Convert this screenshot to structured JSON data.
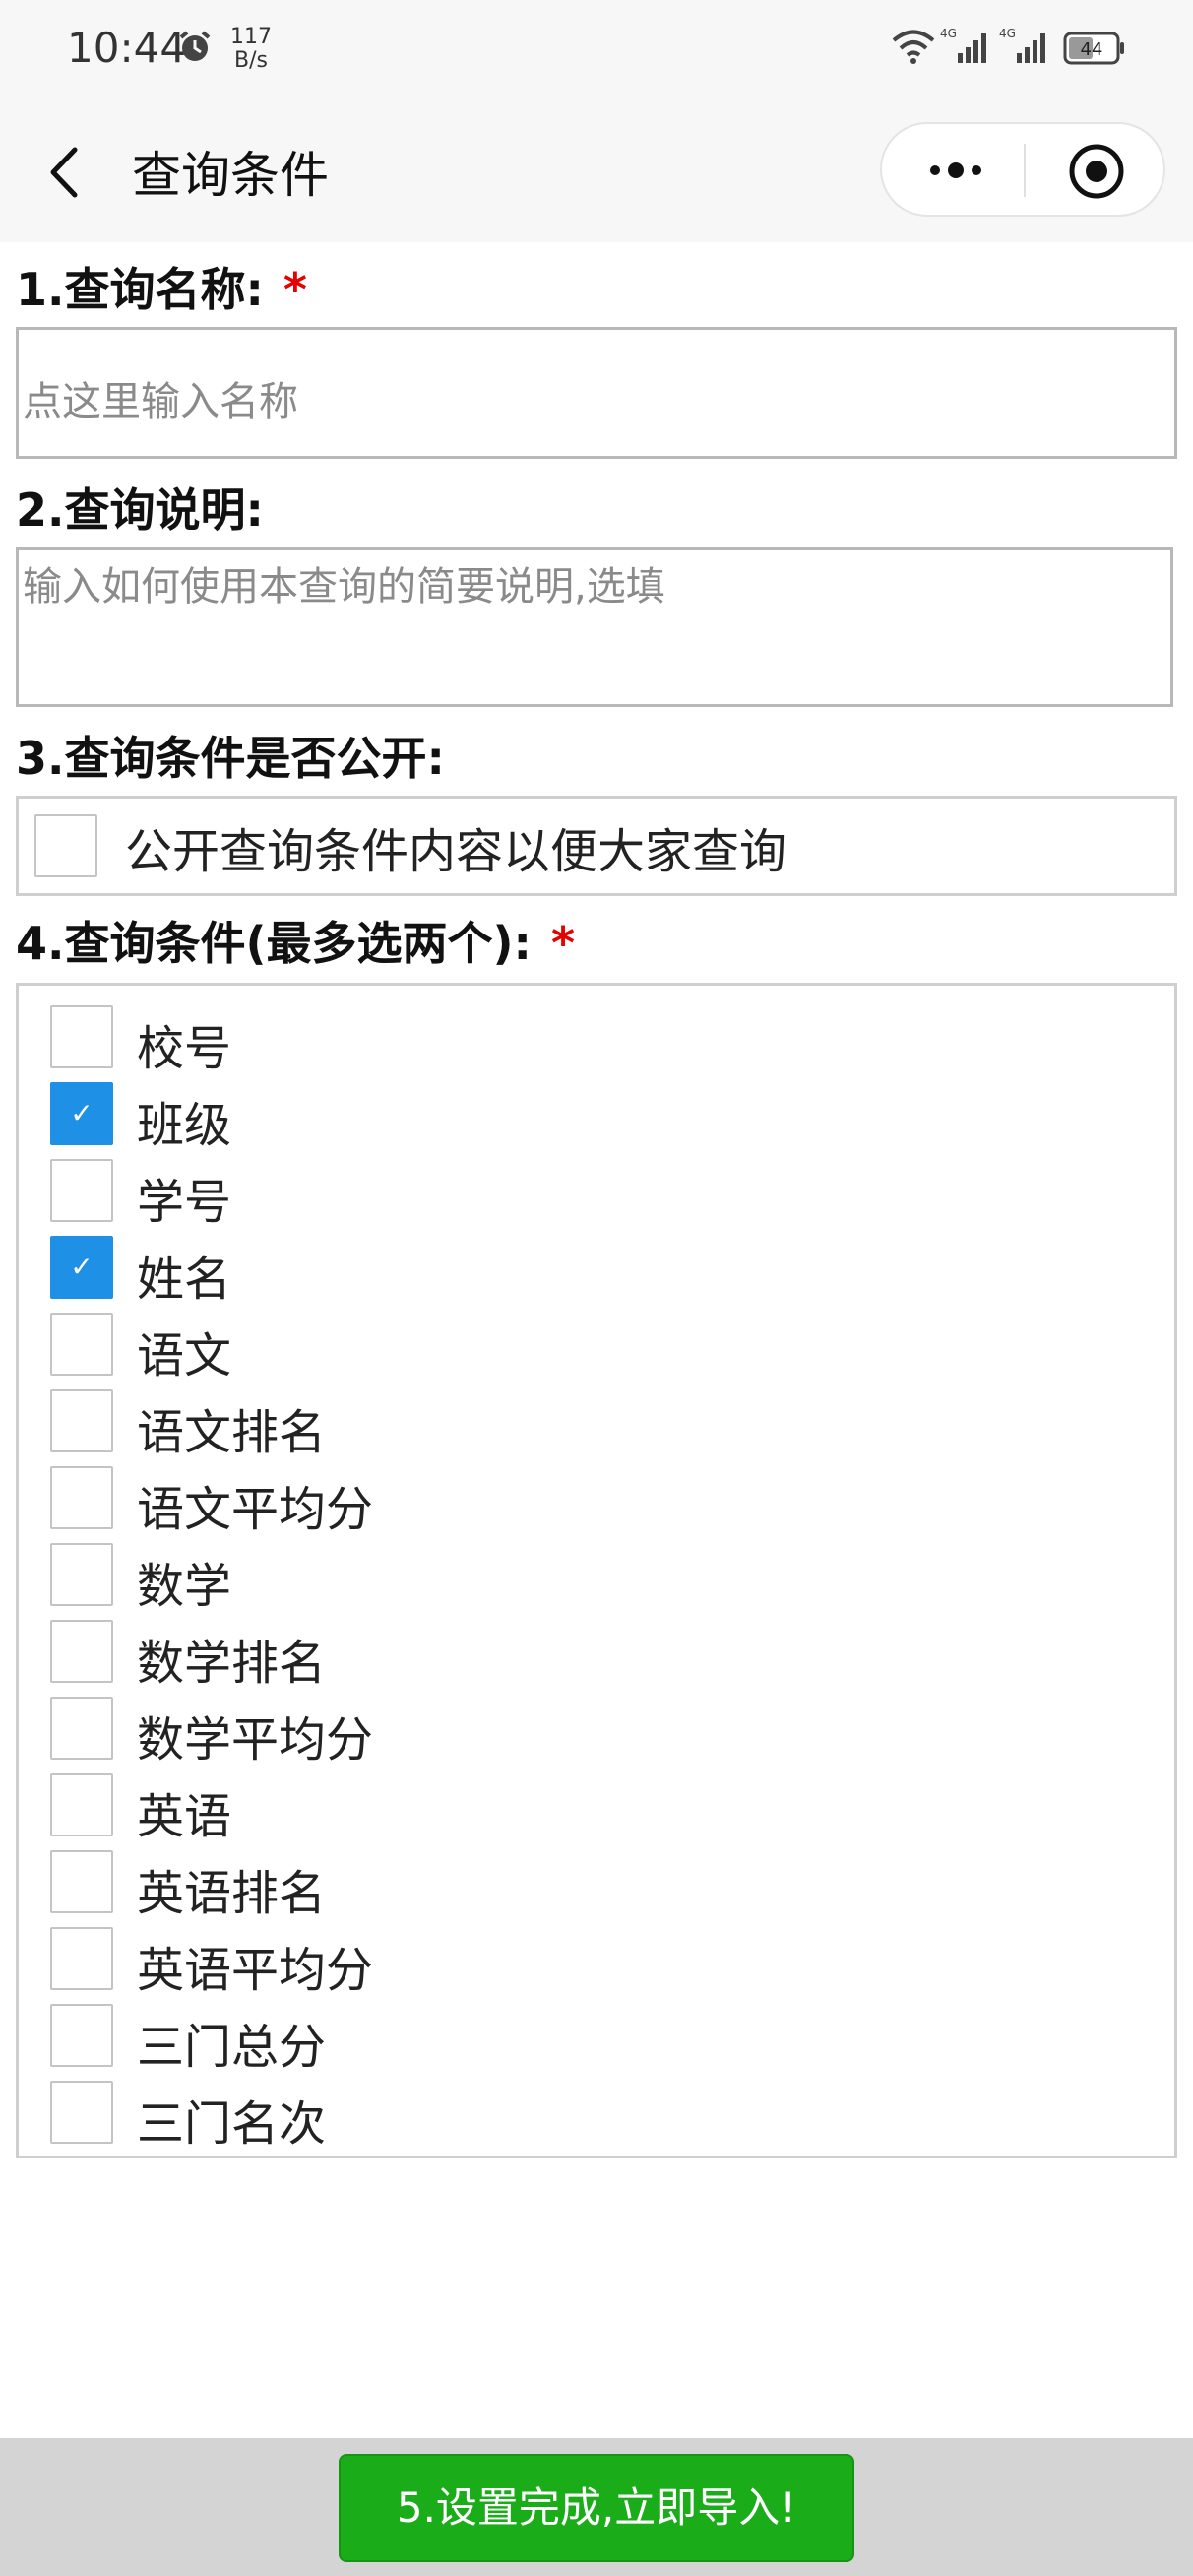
{
  "status_bar": {
    "time": "10:44",
    "net_speed_value": "117",
    "net_speed_unit": "B/s",
    "network_1": "4G",
    "network_2": "4G",
    "battery": "44"
  },
  "nav": {
    "title": "查询条件"
  },
  "form": {
    "name_label": "1.查询名称:",
    "name_required": "*",
    "name_placeholder": "点这里输入名称",
    "desc_label": "2.查询说明:",
    "desc_placeholder": "输入如何使用本查询的简要说明,选填",
    "public_label": "3.查询条件是否公开:",
    "public_checkbox_label": "公开查询条件内容以便大家查询",
    "public_checked": false,
    "conditions_label": "4.查询条件(最多选两个):",
    "conditions_required": "*",
    "options": [
      {
        "label": "校号",
        "checked": false
      },
      {
        "label": "班级",
        "checked": true
      },
      {
        "label": "学号",
        "checked": false
      },
      {
        "label": "姓名",
        "checked": true
      },
      {
        "label": "语文",
        "checked": false
      },
      {
        "label": "语文排名",
        "checked": false
      },
      {
        "label": "语文平均分",
        "checked": false
      },
      {
        "label": "数学",
        "checked": false
      },
      {
        "label": "数学排名",
        "checked": false
      },
      {
        "label": "数学平均分",
        "checked": false
      },
      {
        "label": "英语",
        "checked": false
      },
      {
        "label": "英语排名",
        "checked": false
      },
      {
        "label": "英语平均分",
        "checked": false
      },
      {
        "label": "三门总分",
        "checked": false
      },
      {
        "label": "三门名次",
        "checked": false
      }
    ]
  },
  "footer": {
    "submit_label": "5.设置完成,立即导入!"
  },
  "colors": {
    "accent_checkbox": "#1e90e6",
    "submit_button": "#1aad19",
    "required_star": "#e60000"
  }
}
